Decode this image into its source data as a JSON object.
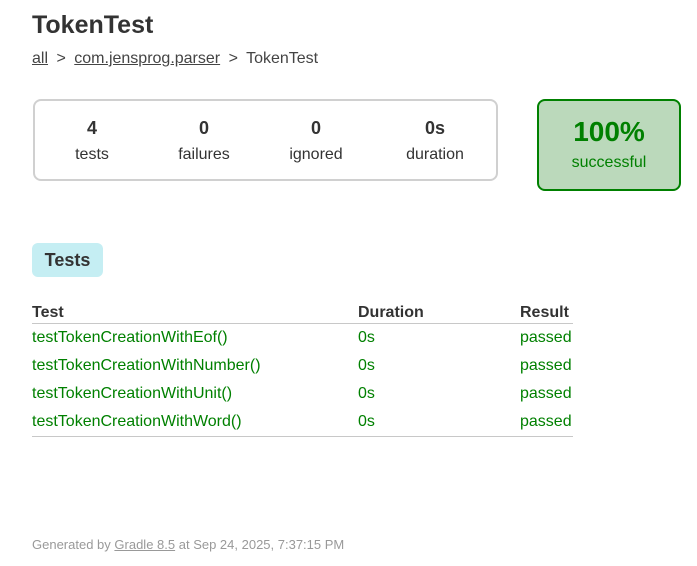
{
  "page": {
    "title": "TokenTest"
  },
  "breadcrumb": {
    "all": "all",
    "separator": ">",
    "package": "com.jensprog.parser",
    "current": "TokenTest"
  },
  "summary": {
    "tests": {
      "value": "4",
      "label": "tests"
    },
    "failures": {
      "value": "0",
      "label": "failures"
    },
    "ignored": {
      "value": "0",
      "label": "ignored"
    },
    "duration": {
      "value": "0s",
      "label": "duration"
    }
  },
  "success": {
    "percent": "100%",
    "label": "successful",
    "color": "#008000",
    "background": "#bbd9bb"
  },
  "tabs": {
    "tests_label": "Tests"
  },
  "table": {
    "headers": [
      "Test",
      "Duration",
      "Result"
    ],
    "rows": [
      {
        "test": "testTokenCreationWithEof()",
        "duration": "0s",
        "result": "passed"
      },
      {
        "test": "testTokenCreationWithNumber()",
        "duration": "0s",
        "result": "passed"
      },
      {
        "test": "testTokenCreationWithUnit()",
        "duration": "0s",
        "result": "passed"
      },
      {
        "test": "testTokenCreationWithWord()",
        "duration": "0s",
        "result": "passed"
      }
    ]
  },
  "footer": {
    "prefix": "Generated by",
    "link": "Gradle 8.5",
    "suffix": "at Sep 24, 2025, 7:37:15 PM"
  }
}
